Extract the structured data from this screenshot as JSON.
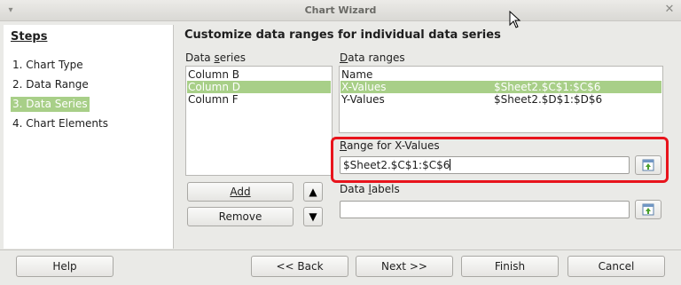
{
  "window": {
    "title": "Chart Wizard",
    "menu_icon": "down-arrow-icon",
    "close_icon": "close-icon"
  },
  "steps": {
    "title": "Steps",
    "items": [
      {
        "label": "1. Chart Type",
        "active": false
      },
      {
        "label": "2. Data Range",
        "active": false
      },
      {
        "label": "3. Data Series",
        "active": true
      },
      {
        "label": "4. Chart Elements",
        "active": false
      }
    ]
  },
  "main": {
    "heading": "Customize data ranges for individual data series",
    "data_series": {
      "label": "Data series",
      "items": [
        {
          "label": "Column B",
          "selected": false
        },
        {
          "label": "Column D",
          "selected": true
        },
        {
          "label": "Column F",
          "selected": false
        }
      ],
      "add_label": "Add",
      "remove_label": "Remove",
      "up_icon": "▲",
      "down_icon": "▼"
    },
    "data_ranges": {
      "label": "Data ranges",
      "rows": [
        {
          "name": "Name",
          "range": "",
          "selected": false
        },
        {
          "name": "X-Values",
          "range": "$Sheet2.$C$1:$C$6",
          "selected": true
        },
        {
          "name": "Y-Values",
          "range": "$Sheet2.$D$1:$D$6",
          "selected": false
        }
      ]
    },
    "range_for": {
      "label": "Range for X-Values",
      "value": "$Sheet2.$C$1:$C$6"
    },
    "data_labels": {
      "label": "Data labels",
      "value": ""
    }
  },
  "footer": {
    "help": "Help",
    "back": "<< Back",
    "next": "Next >>",
    "finish": "Finish",
    "cancel": "Cancel"
  },
  "colors": {
    "selection": "#a8cf88",
    "highlight_outline": "#e8141c"
  }
}
